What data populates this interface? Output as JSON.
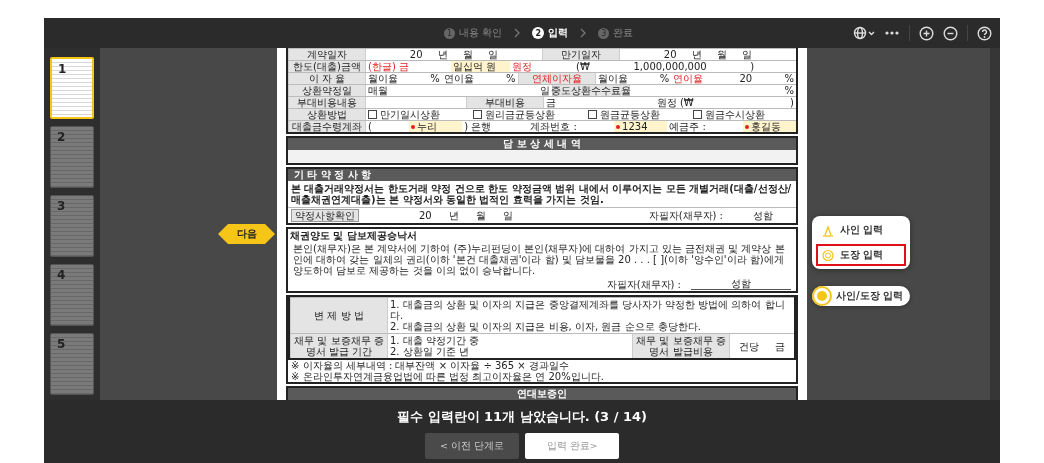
{
  "steps": [
    {
      "number": "1",
      "label": "내용 확인",
      "selected": false
    },
    {
      "number": "2",
      "label": "입력",
      "selected": true
    },
    {
      "number": "3",
      "label": "완료",
      "selected": false
    }
  ],
  "thumbnails": [
    {
      "number": "1",
      "selected": true
    },
    {
      "number": "2",
      "selected": false
    },
    {
      "number": "3",
      "selected": false
    },
    {
      "number": "4",
      "selected": false
    },
    {
      "number": "5",
      "selected": false
    }
  ],
  "document": {
    "loan_table": [
      [
        {
          "kind": "head",
          "text": "계약일자"
        },
        {
          "kind": "date",
          "text": "20 년 월 일"
        },
        {
          "kind": "head",
          "text": "만기일자"
        },
        {
          "kind": "date",
          "text": "20 년 월 일"
        }
      ],
      [
        {
          "kind": "head",
          "text": "한도(대출)금액"
        },
        {
          "kind": "red",
          "text": "(한글) 금"
        },
        {
          "kind": "input",
          "text": "일십억 원",
          "required": false
        },
        {
          "kind": "red",
          "text": "원정"
        },
        {
          "kind": "text",
          "text": "(₩"
        },
        {
          "kind": "text",
          "text": "1,000,000,000"
        },
        {
          "kind": "text",
          "text": ")"
        }
      ],
      [
        {
          "kind": "head",
          "text": "이 자 율"
        },
        {
          "kind": "text",
          "text": "월이율",
          "unit": "%"
        },
        {
          "kind": "text",
          "text": "연이율",
          "unit": "%"
        },
        {
          "kind": "redhead",
          "text": "연체이자율"
        },
        {
          "kind": "text",
          "text": "월이율",
          "unit": "%"
        },
        {
          "kind": "red",
          "text": "연이율"
        },
        {
          "kind": "text",
          "text": "20",
          "unit": "%"
        }
      ],
      [
        {
          "kind": "head",
          "text": "상환약정일"
        },
        {
          "kind": "text",
          "text": "매월",
          "unit": "일"
        },
        {
          "kind": "head",
          "text": "중도상환수수료율"
        },
        {
          "kind": "text",
          "unit": "%"
        }
      ],
      [
        {
          "kind": "head",
          "text": "부대비용내용"
        },
        {
          "kind": "text"
        },
        {
          "kind": "head",
          "text": "부대비용"
        },
        {
          "kind": "text",
          "text": "금"
        },
        {
          "kind": "text",
          "text": "원정 (₩",
          "unit": ")"
        }
      ],
      [
        {
          "kind": "head",
          "text": "상환방법"
        },
        {
          "kind": "check",
          "text": "만기일시상환",
          "checked": false
        },
        {
          "kind": "check",
          "text": "원리금균등상환",
          "checked": false
        },
        {
          "kind": "check",
          "text": "원금균등상환",
          "checked": false
        },
        {
          "kind": "check",
          "text": "원금수시상환",
          "checked": false
        }
      ],
      [
        {
          "kind": "head",
          "text": "대출금수령계좌"
        },
        {
          "kind": "text",
          "text": "("
        },
        {
          "kind": "input",
          "text": "누리",
          "required": true
        },
        {
          "kind": "text",
          "text": ") 은행"
        },
        {
          "kind": "text",
          "text": "계좌번호 :"
        },
        {
          "kind": "input",
          "text": "1234",
          "required": true
        },
        {
          "kind": "text",
          "text": "예금주 :"
        },
        {
          "kind": "input",
          "text": "홍길동",
          "required": true
        }
      ]
    ],
    "collateral": {
      "title": "담 보 상 세 내 역"
    },
    "terms": {
      "title": "기 타 약 정 사 항",
      "text": "본 대출거래약정서는 한도거래 약정 건으로 한도 약정금액 범위 내에서 이루어지는 모든 개별거래(대출/선정산/매출채권연계대출)는 본 약정서와 동일한 법적인 효력을 가지는 것임.",
      "confirm_label": "약정사항확인",
      "date": "20 년 월 일",
      "signer": "자필자(채무자) :",
      "seal": "성함"
    },
    "assignment": {
      "title": "채권양도 및 담보제공승낙서",
      "text": "본인(채무자)은 본 계약서에 기하여 (주)누리펀딩이 본인(채무자)에 대하여 가지고 있는 금전채권 및 계약상 본인에 대하여 갖는 일체의 권리(이하 '본건 대출채권'이라 함) 및 담보물을 20 . . . [ ](이하 '양수인'이라 함)에게 양도하여 담보로 제공하는 것을 이의 없이 승낙합니다.",
      "signer": "자필자(채무자) :",
      "seal": "성함"
    },
    "repayment": [
      [
        {
          "kind": "head",
          "text": "변 제 방 법"
        },
        {
          "kind": "text",
          "text": "1. 대출금의 상환 및 이자의 지급은 중앙결제계좌를 당사자가 약정한 방법에 의하여 합니다.\n2. 대출금의 상환 및 이자의 지급은 비용, 이자, 원금 순으로 충당한다."
        }
      ],
      [
        {
          "kind": "head",
          "text": "채무 및 보증채무 증명서 발급 기간"
        },
        {
          "kind": "text",
          "text": "1. 대출 약정기간 중\n2. 상환일 기준 년"
        },
        {
          "kind": "head",
          "text": "채무 및 보증채무 증명서 발급비용"
        },
        {
          "kind": "date",
          "text": "건당 금"
        }
      ]
    ],
    "notes": [
      "※ 이자율의 세부내역 : 대부잔액 × 이자율 ÷ 365 × 경과일수",
      "※ 온라인투자연계금융업법에 따른 법정 최고이자율은 연 20%입니다."
    ],
    "guarantor": {
      "title": "연대보증인"
    }
  },
  "next_tag": "다음",
  "input_menu": [
    {
      "kind": "sign",
      "label": "사인 입력",
      "selected": false
    },
    {
      "kind": "seal",
      "label": "도장 입력",
      "selected": true
    }
  ],
  "input_button": "사인/도장 입력",
  "status": {
    "message": "필수 입력란이 11개 남았습니다. (3 / 14)",
    "buttons": [
      {
        "label": "< 이전 단계로",
        "disabled": false
      },
      {
        "label": "입력 완료>",
        "disabled": true
      }
    ]
  }
}
